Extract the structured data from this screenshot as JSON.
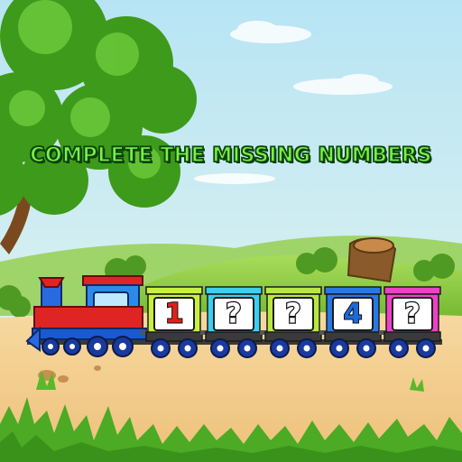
{
  "title": "COMPLETE THE MISSING NUMBERS",
  "cards": [
    {
      "text": "1",
      "kind": "number",
      "color": "#e0201c",
      "car_color": "#c8f03c"
    },
    {
      "text": "?",
      "kind": "question",
      "color": "#ffffff",
      "car_color": "#3ad0f0"
    },
    {
      "text": "?",
      "kind": "question",
      "color": "#ffffff",
      "car_color": "#b8e840"
    },
    {
      "text": "4",
      "kind": "number",
      "color": "#1c6ad8",
      "car_color": "#2878e8"
    },
    {
      "text": "?",
      "kind": "question",
      "color": "#ffffff",
      "car_color": "#f040c8"
    }
  ],
  "colors": {
    "sky": "#bfe6f2",
    "ground": "#f2c98a",
    "grass": "#7cc43a",
    "title_fill": "#7cf04a",
    "engine_red": "#e02424",
    "engine_blue": "#1a8ce0"
  },
  "icons": {
    "tree": "tree-icon",
    "stump": "tree-stump-icon",
    "engine": "locomotive-icon"
  }
}
